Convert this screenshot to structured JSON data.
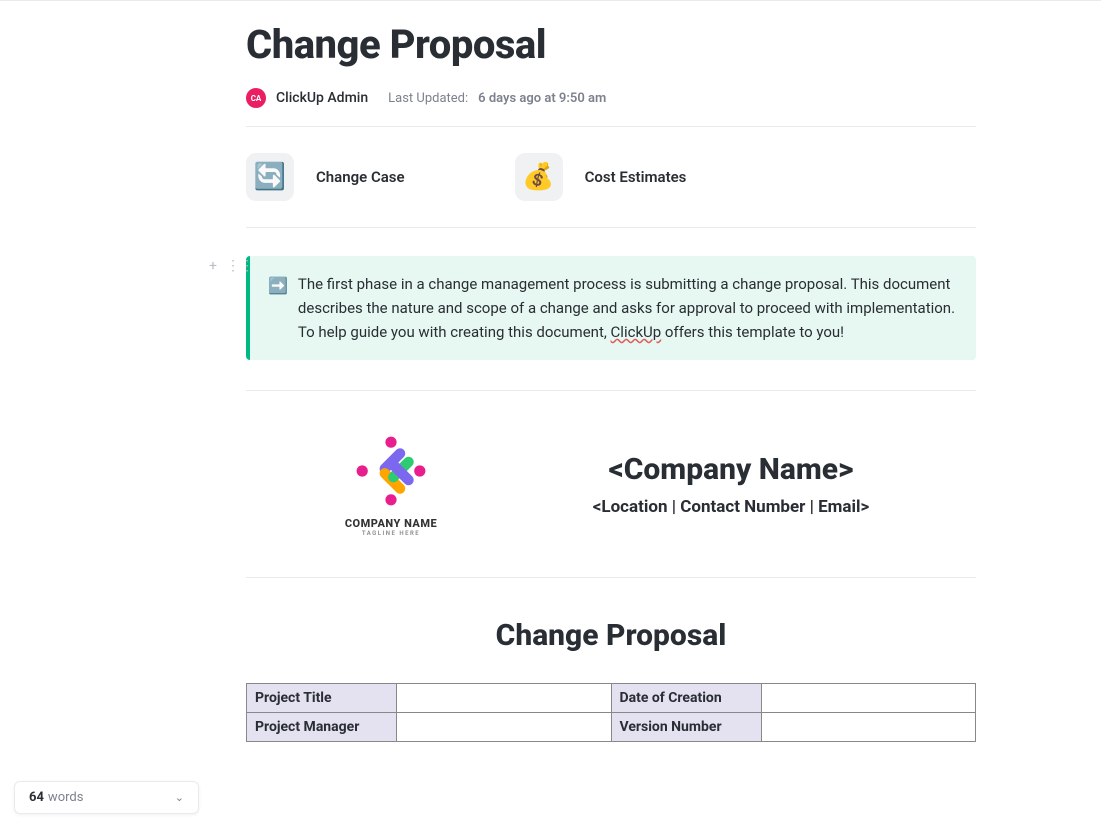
{
  "title": "Change Proposal",
  "meta": {
    "avatar_initials": "CA",
    "author": "ClickUp Admin",
    "updated_label": "Last Updated:",
    "updated_value": "6 days ago at 9:50 am"
  },
  "cards": [
    {
      "icon": "🔄",
      "label": "Change Case"
    },
    {
      "icon": "💰",
      "label": "Cost Estimates"
    }
  ],
  "callout": {
    "emoji": "➡️",
    "text_before": "The first phase in a change management process is submitting a change proposal. This document describes the nature and scope of a change and asks for approval to proceed with implementation. To help guide you with creating this document, ",
    "link_text": "ClickUp",
    "text_after": " offers this template to you!"
  },
  "company": {
    "logo_name": "COMPANY NAME",
    "logo_tagline": "TAGLINE HERE",
    "name_placeholder": "<Company Name>",
    "contact_placeholder": "<Location | Contact Number | Email>"
  },
  "section_title": "Change Proposal",
  "info_table": {
    "rows": [
      {
        "label1": "Project Title",
        "value1": "",
        "label2": "Date of Creation",
        "value2": ""
      },
      {
        "label1": "Project Manager",
        "value1": "",
        "label2": "Version Number",
        "value2": ""
      }
    ]
  },
  "word_counter": {
    "count": "64",
    "label": "words"
  }
}
